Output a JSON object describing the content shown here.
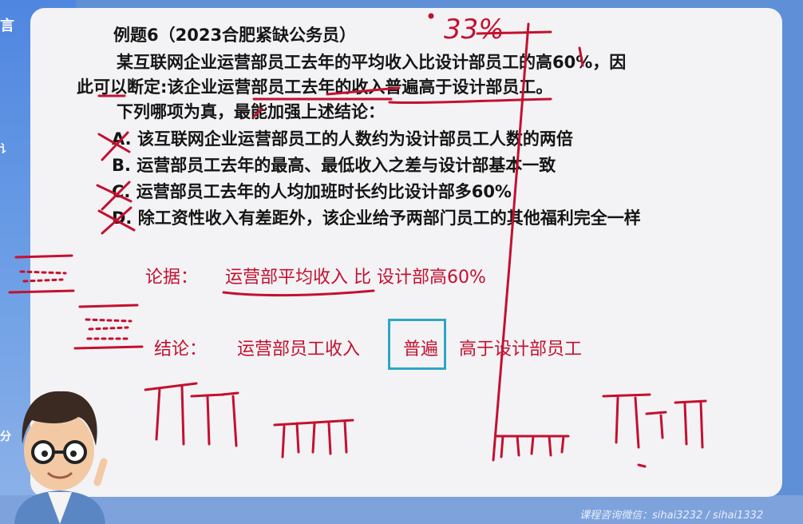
{
  "slide": {
    "title": "例题6（2023合肥紧缺公务员）",
    "question_line1": "某互联网企业运营部员工去年的平均收入比设计部员工的高60%，因",
    "question_line2": "此可以断定:该企业运营部员工去年的收入普遍高于设计部员工。",
    "prompt": "下列哪项为真，最能加强上述结论：",
    "options": [
      {
        "letter": "A.",
        "text": "该互联网企业运营部员工的人数约为设计部员工人数的两倍",
        "crossed": true
      },
      {
        "letter": "B.",
        "text": "运营部员工去年的最高、最低收入之差与设计部基本一致",
        "crossed": false
      },
      {
        "letter": "C.",
        "text": "运营部员工去年的人均加班时长约比设计部多60%",
        "crossed": true
      },
      {
        "letter": "D.",
        "text": "除工资性收入有差距外，该企业给予两部门员工的其他福利完全一样",
        "crossed": true
      }
    ]
  },
  "annotations": {
    "note_top": "33%",
    "evidence_label": "论据：",
    "evidence_text": "运营部平均收入 比 设计部高60%",
    "conclusion_label": "结论：",
    "conclusion_part1": "运营部员工收入",
    "conclusion_highlight": "普遍",
    "conclusion_part2": "高于设计部员工"
  },
  "colors": {
    "ink_red": "#c4102f",
    "highlight_box": "#2ea6c4",
    "slide_bg": "#f3f3f5",
    "frame_blue": "#5f8fd6"
  },
  "footer": {
    "contact": "课程咨询微信：sihai3232 / sihai1332"
  },
  "sidebar": {
    "logo_fragment": "言",
    "glyph_1": "讠",
    "glyph_2": "分"
  }
}
